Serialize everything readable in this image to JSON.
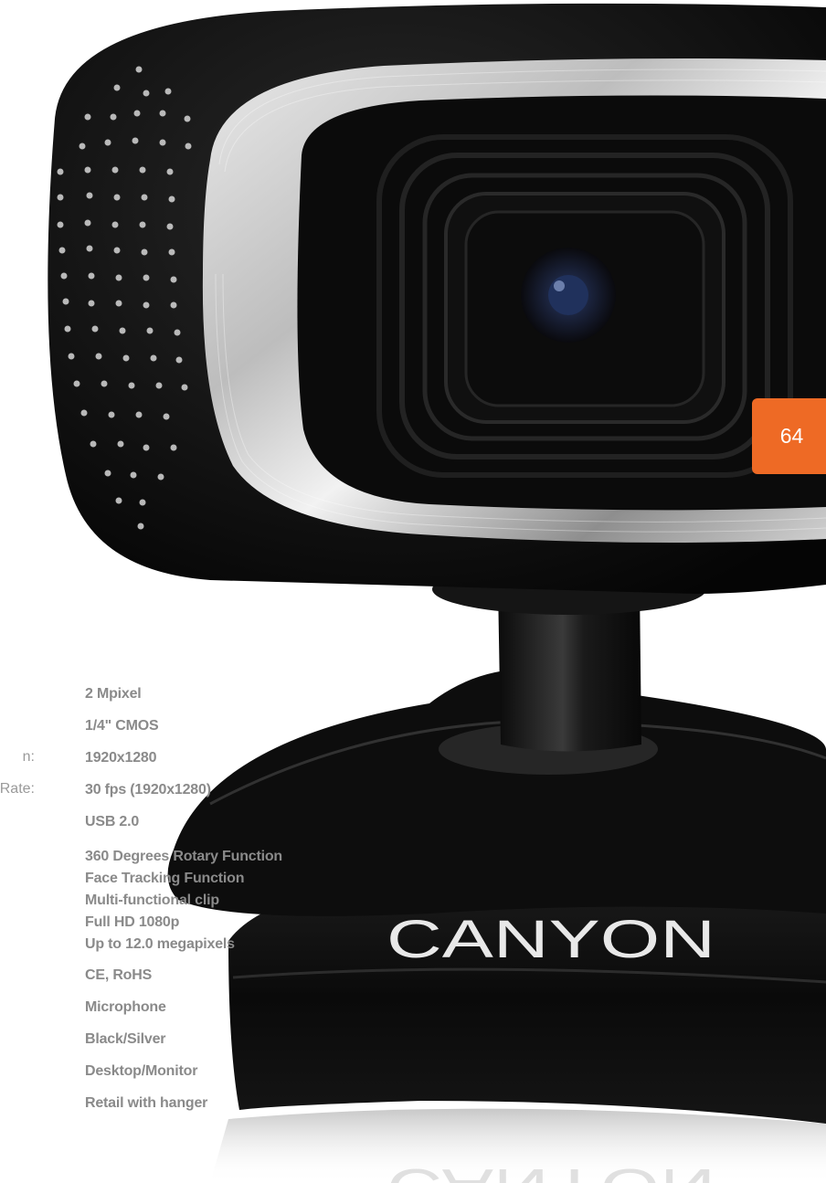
{
  "page_number": "64",
  "brand_logo": "CANYON",
  "product_image": "webcam-black-silver",
  "colors": {
    "badge": "#ee6a25",
    "spec_text": "#8a8a8a",
    "label_text": "#9a9a9a"
  },
  "spec_labels": [
    "n:",
    "Rate:"
  ],
  "spec_values": [
    "2 Mpixel",
    "1/4\" CMOS",
    "1920x1280",
    "30 fps (1920x1280)",
    "USB 2.0",
    "360 Degrees Rotary Function",
    "Face Tracking Function",
    "Multi-functional clip",
    "Full HD 1080p",
    "Up to 12.0 megapixels",
    "CE, RoHS",
    "Microphone",
    "Black/Silver",
    "Desktop/Monitor",
    "Retail with hanger"
  ]
}
